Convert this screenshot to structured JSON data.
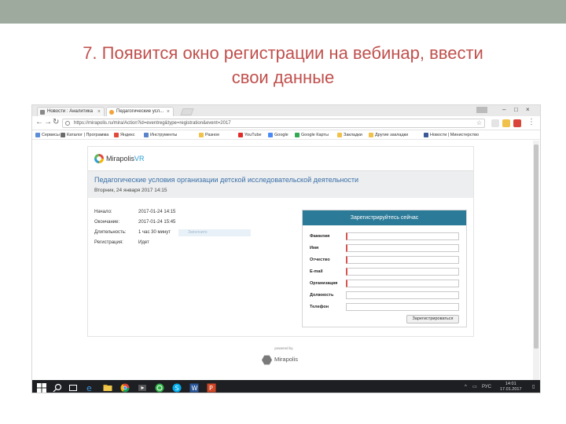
{
  "slide": {
    "title_line1": "7. Появится окно регистрации на вебинар, ввести",
    "title_line2": "свои данные",
    "colors": {
      "topbar": "#9daa9d",
      "title": "#c0504d"
    }
  },
  "browser": {
    "tabs": [
      {
        "label": "Новости : Аналитика",
        "active": false
      },
      {
        "label": "Педагогические усл...",
        "active": true
      }
    ],
    "address": "https://mirapolis.ru/mira/Action?id=eventreg&type=registration&event=2017",
    "bookmarks": [
      "Сервисы",
      "Каталог | Программа",
      "Яндекс",
      "Инструменты",
      "Разное",
      "YouTube",
      "Google",
      "Google Карты",
      "Закладки",
      "Другие закладки",
      "Новости | Министерство"
    ]
  },
  "page": {
    "logo": {
      "name": "Mirapolis",
      "suffix": "VR"
    },
    "event_title": "Педагогические условия организации детской исследовательской деятельности",
    "event_date": "Вторник, 24 января 2017 14:15",
    "details": [
      {
        "key": "Начало:",
        "value": "2017-01-24 14:15"
      },
      {
        "key": "Окончание:",
        "value": "2017-01-24 15:45"
      },
      {
        "key": "Длительность:",
        "value": "1 час 30 минут"
      },
      {
        "key": "Регистрация:",
        "value": "Идет"
      }
    ],
    "ghost_field": "Заполните",
    "registration": {
      "header": "Зарегистрируйтесь сейчас",
      "fields": [
        {
          "label": "Фамилия",
          "required": true
        },
        {
          "label": "Имя",
          "required": true
        },
        {
          "label": "Отчество",
          "required": true
        },
        {
          "label": "E-mail",
          "required": true
        },
        {
          "label": "Организация",
          "required": true
        },
        {
          "label": "Должность",
          "required": false
        },
        {
          "label": "Телефон",
          "required": false
        }
      ],
      "submit": "Зарегистрироваться",
      "accent": "#2b7a98"
    },
    "footer": {
      "powered": "powered by",
      "brand": "Mirapolis"
    }
  },
  "taskbar": {
    "lang": "РУС",
    "time": "14:01",
    "date": "17.01.2017"
  }
}
